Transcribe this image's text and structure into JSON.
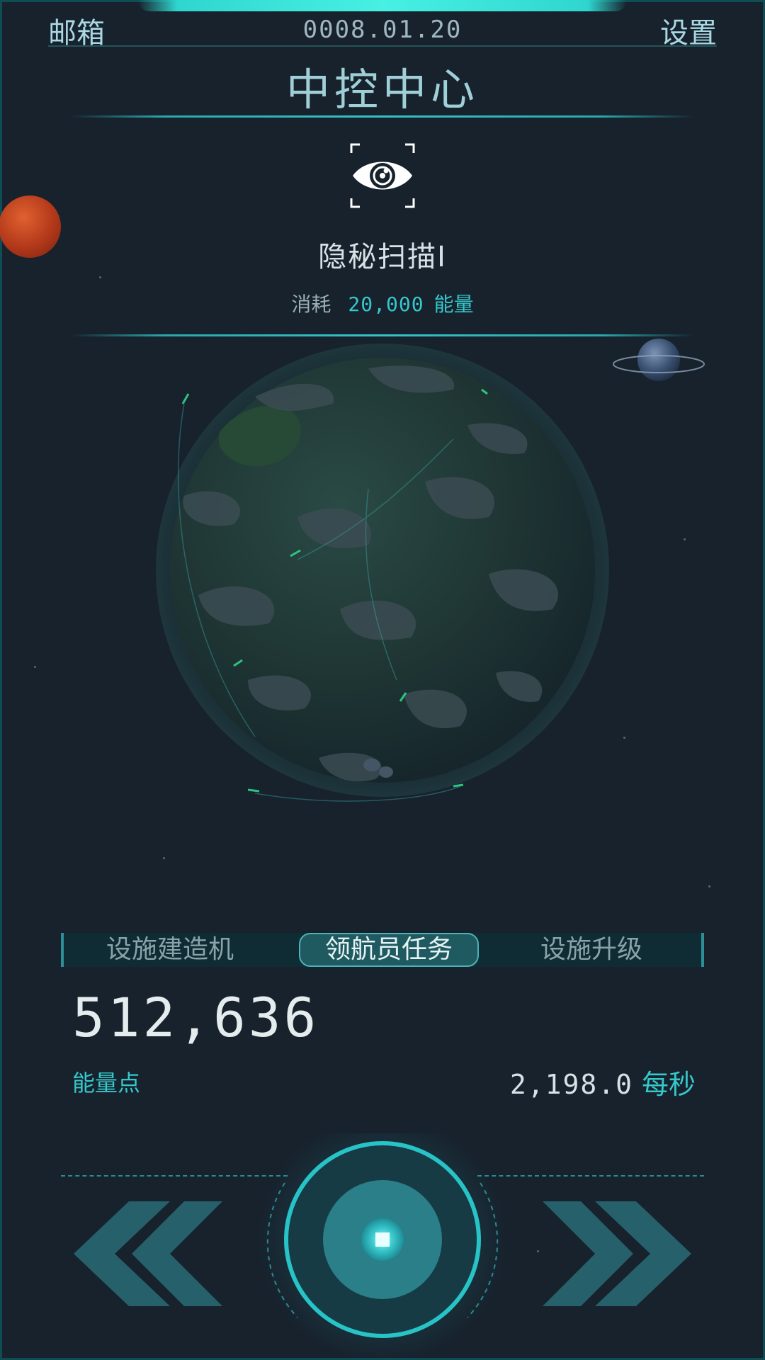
{
  "header": {
    "mail_label": "邮箱",
    "date": "0008.01.20",
    "settings_label": "设置",
    "title": "中控中心"
  },
  "skill": {
    "icon": "eye-scan-icon",
    "name": "隐秘扫描I",
    "cost_label": "消耗",
    "cost_value": "20,000",
    "cost_unit": "能量"
  },
  "tabs": [
    {
      "label": "设施建造机",
      "active": false
    },
    {
      "label": "领航员任务",
      "active": true
    },
    {
      "label": "设施升级",
      "active": false
    }
  ],
  "resources": {
    "energy_amount": "512,636",
    "energy_label": "能量点",
    "rate_value": "2,198.0",
    "rate_unit": "每秒"
  },
  "controls": {
    "prev_icon": "double-chevron-left-icon",
    "center_icon": "stop-square-icon",
    "next_icon": "double-chevron-right-icon"
  },
  "colors": {
    "accent": "#35c8cc",
    "background": "#17222d",
    "frame": "#0f4d55"
  }
}
